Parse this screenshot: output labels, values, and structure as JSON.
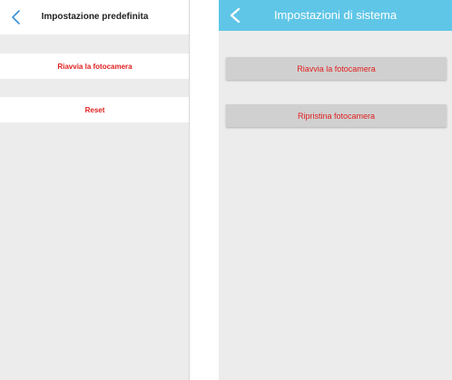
{
  "left_screen": {
    "title": "Impostazione predefinita",
    "back_icon": "chevron-left-icon",
    "items": [
      {
        "label": "Riavvia la fotocamera"
      },
      {
        "label": "Reset"
      }
    ]
  },
  "right_screen": {
    "title": "Impostazioni di sistema",
    "back_icon": "chevron-left-icon",
    "buttons": [
      {
        "label": "Riavvia la fotocamera"
      },
      {
        "label": "Ripristina fotocamera"
      }
    ]
  },
  "colors": {
    "accent_red": "#e02020",
    "right_header": "#5fc6e7",
    "left_back_icon": "#3a8fd8",
    "background_gray": "#ececec",
    "button_gray": "#d0d0d0"
  }
}
